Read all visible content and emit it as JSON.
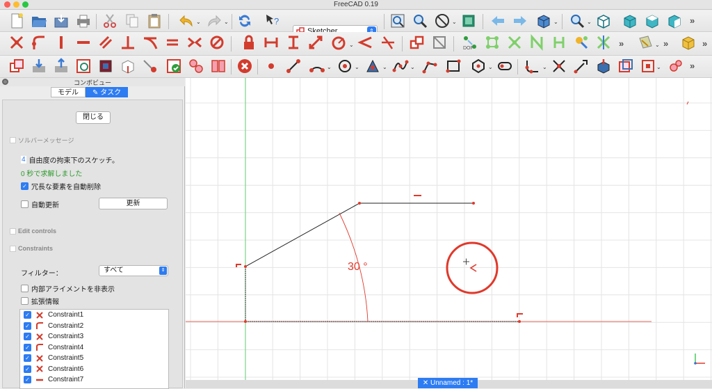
{
  "app": {
    "title": "FreeCAD 0.19"
  },
  "workbench": {
    "selected": "Sketcher"
  },
  "panel": {
    "header": "コンボビュー",
    "tabs": [
      "モデル",
      "タスク"
    ],
    "close_button": "閉じる",
    "solver_section": "ソルバーメッセージ",
    "dof_count": "4",
    "dof_text": "自由度の拘束下のスケッチ。",
    "solved_text": "0 秒で求解しました",
    "auto_remove_label": "冗長な要素を自動削除",
    "auto_update_label": "自動更新",
    "update_button": "更新",
    "edit_controls_section": "Edit controls",
    "constraints_section": "Constraints",
    "filter_label": "フィルター：",
    "filter_value": "すべて",
    "hide_internal_label": "内部アライメントを非表示",
    "extended_info_label": "拡張情報",
    "constraints": [
      {
        "name": "Constraint1",
        "icon": "coincident-icon"
      },
      {
        "name": "Constraint2",
        "icon": "point-on-object-icon"
      },
      {
        "name": "Constraint3",
        "icon": "coincident-icon"
      },
      {
        "name": "Constraint4",
        "icon": "point-on-object-icon"
      },
      {
        "name": "Constraint5",
        "icon": "coincident-icon"
      },
      {
        "name": "Constraint6",
        "icon": "coincident-icon"
      },
      {
        "name": "Constraint7",
        "icon": "horizontal-icon"
      }
    ]
  },
  "canvas": {
    "angle_label": "30 °"
  },
  "statusbar": {
    "doc_tab": "Unnamed : 1*"
  },
  "colors": {
    "accent": "#2d7cf2",
    "constraint_red": "#e0392b",
    "axis_green": "#45c85a"
  }
}
